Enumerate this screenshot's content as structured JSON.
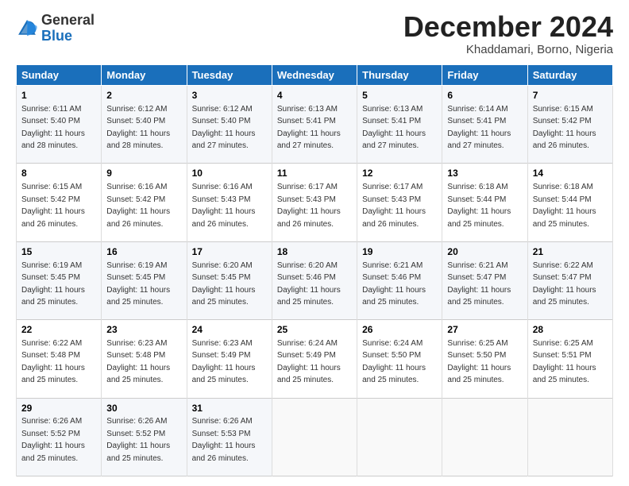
{
  "header": {
    "logo": {
      "line1": "General",
      "line2": "Blue"
    },
    "title": "December 2024",
    "subtitle": "Khaddamari, Borno, Nigeria"
  },
  "weekdays": [
    "Sunday",
    "Monday",
    "Tuesday",
    "Wednesday",
    "Thursday",
    "Friday",
    "Saturday"
  ],
  "weeks": [
    [
      {
        "day": "1",
        "sunrise": "6:11 AM",
        "sunset": "5:40 PM",
        "daylight": "11 hours and 28 minutes."
      },
      {
        "day": "2",
        "sunrise": "6:12 AM",
        "sunset": "5:40 PM",
        "daylight": "11 hours and 28 minutes."
      },
      {
        "day": "3",
        "sunrise": "6:12 AM",
        "sunset": "5:40 PM",
        "daylight": "11 hours and 27 minutes."
      },
      {
        "day": "4",
        "sunrise": "6:13 AM",
        "sunset": "5:41 PM",
        "daylight": "11 hours and 27 minutes."
      },
      {
        "day": "5",
        "sunrise": "6:13 AM",
        "sunset": "5:41 PM",
        "daylight": "11 hours and 27 minutes."
      },
      {
        "day": "6",
        "sunrise": "6:14 AM",
        "sunset": "5:41 PM",
        "daylight": "11 hours and 27 minutes."
      },
      {
        "day": "7",
        "sunrise": "6:15 AM",
        "sunset": "5:42 PM",
        "daylight": "11 hours and 26 minutes."
      }
    ],
    [
      {
        "day": "8",
        "sunrise": "6:15 AM",
        "sunset": "5:42 PM",
        "daylight": "11 hours and 26 minutes."
      },
      {
        "day": "9",
        "sunrise": "6:16 AM",
        "sunset": "5:42 PM",
        "daylight": "11 hours and 26 minutes."
      },
      {
        "day": "10",
        "sunrise": "6:16 AM",
        "sunset": "5:43 PM",
        "daylight": "11 hours and 26 minutes."
      },
      {
        "day": "11",
        "sunrise": "6:17 AM",
        "sunset": "5:43 PM",
        "daylight": "11 hours and 26 minutes."
      },
      {
        "day": "12",
        "sunrise": "6:17 AM",
        "sunset": "5:43 PM",
        "daylight": "11 hours and 26 minutes."
      },
      {
        "day": "13",
        "sunrise": "6:18 AM",
        "sunset": "5:44 PM",
        "daylight": "11 hours and 25 minutes."
      },
      {
        "day": "14",
        "sunrise": "6:18 AM",
        "sunset": "5:44 PM",
        "daylight": "11 hours and 25 minutes."
      }
    ],
    [
      {
        "day": "15",
        "sunrise": "6:19 AM",
        "sunset": "5:45 PM",
        "daylight": "11 hours and 25 minutes."
      },
      {
        "day": "16",
        "sunrise": "6:19 AM",
        "sunset": "5:45 PM",
        "daylight": "11 hours and 25 minutes."
      },
      {
        "day": "17",
        "sunrise": "6:20 AM",
        "sunset": "5:45 PM",
        "daylight": "11 hours and 25 minutes."
      },
      {
        "day": "18",
        "sunrise": "6:20 AM",
        "sunset": "5:46 PM",
        "daylight": "11 hours and 25 minutes."
      },
      {
        "day": "19",
        "sunrise": "6:21 AM",
        "sunset": "5:46 PM",
        "daylight": "11 hours and 25 minutes."
      },
      {
        "day": "20",
        "sunrise": "6:21 AM",
        "sunset": "5:47 PM",
        "daylight": "11 hours and 25 minutes."
      },
      {
        "day": "21",
        "sunrise": "6:22 AM",
        "sunset": "5:47 PM",
        "daylight": "11 hours and 25 minutes."
      }
    ],
    [
      {
        "day": "22",
        "sunrise": "6:22 AM",
        "sunset": "5:48 PM",
        "daylight": "11 hours and 25 minutes."
      },
      {
        "day": "23",
        "sunrise": "6:23 AM",
        "sunset": "5:48 PM",
        "daylight": "11 hours and 25 minutes."
      },
      {
        "day": "24",
        "sunrise": "6:23 AM",
        "sunset": "5:49 PM",
        "daylight": "11 hours and 25 minutes."
      },
      {
        "day": "25",
        "sunrise": "6:24 AM",
        "sunset": "5:49 PM",
        "daylight": "11 hours and 25 minutes."
      },
      {
        "day": "26",
        "sunrise": "6:24 AM",
        "sunset": "5:50 PM",
        "daylight": "11 hours and 25 minutes."
      },
      {
        "day": "27",
        "sunrise": "6:25 AM",
        "sunset": "5:50 PM",
        "daylight": "11 hours and 25 minutes."
      },
      {
        "day": "28",
        "sunrise": "6:25 AM",
        "sunset": "5:51 PM",
        "daylight": "11 hours and 25 minutes."
      }
    ],
    [
      {
        "day": "29",
        "sunrise": "6:26 AM",
        "sunset": "5:52 PM",
        "daylight": "11 hours and 25 minutes."
      },
      {
        "day": "30",
        "sunrise": "6:26 AM",
        "sunset": "5:52 PM",
        "daylight": "11 hours and 25 minutes."
      },
      {
        "day": "31",
        "sunrise": "6:26 AM",
        "sunset": "5:53 PM",
        "daylight": "11 hours and 26 minutes."
      },
      null,
      null,
      null,
      null
    ]
  ]
}
